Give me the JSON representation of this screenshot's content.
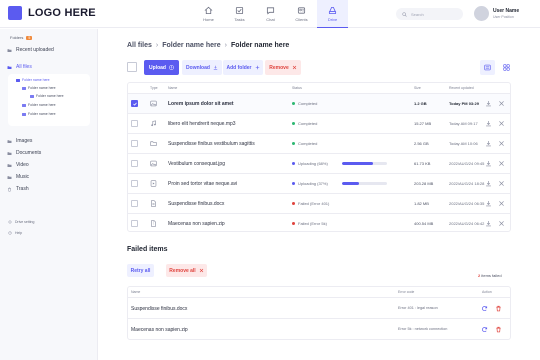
{
  "logo": {
    "text": "LOGO HERE"
  },
  "nav": [
    {
      "label": "Home",
      "icon": "home-icon"
    },
    {
      "label": "Tasks",
      "icon": "tasks-icon"
    },
    {
      "label": "Chat",
      "icon": "chat-icon"
    },
    {
      "label": "Clients",
      "icon": "clients-icon"
    },
    {
      "label": "Drive",
      "icon": "drive-icon",
      "active": true
    }
  ],
  "search": {
    "placeholder": "Search"
  },
  "user": {
    "name": "User Name",
    "position": "User Position"
  },
  "sidebar": {
    "folders_label": "Folders",
    "folders_badge": "5",
    "recent": "Recent uploaded",
    "all_files": "All files",
    "tree": [
      "Folder name here",
      "Folder name here",
      "Folder name here",
      "Folder name here",
      "Folder name here"
    ],
    "categories": [
      "Images",
      "Documents",
      "Video",
      "Music",
      "Trash"
    ],
    "drive_setting": "Drive setting",
    "help": "Help"
  },
  "breadcrumb": [
    "All files",
    "Folder name here",
    "Folder name here"
  ],
  "toolbar": {
    "upload": "Upload",
    "download": "Download",
    "add_folder": "Add folder",
    "remove": "Remove"
  },
  "table": {
    "headers": {
      "type": "Type",
      "name": "Name",
      "status": "Status",
      "size": "Size",
      "recent": "Recent updated"
    },
    "rows": [
      {
        "name": "Lorem ipsum dolor sit amet",
        "status": "Completed",
        "state": "completed",
        "size": "1.2 GB",
        "date": "Today PM 03:29",
        "selected": true,
        "type": "image"
      },
      {
        "name": "libero elit hendrerit neque.mp3",
        "status": "Completed",
        "state": "completed",
        "size": "15.27 MB",
        "date": "Today AM 09:17",
        "type": "music"
      },
      {
        "name": "Suspendisse finibus vestibulum sagittis",
        "status": "Completed",
        "state": "completed",
        "size": "2.56 GB",
        "date": "Today AM 10:06",
        "type": "folder"
      },
      {
        "name": "Vestibulum consequat.jpg",
        "status": "Uploading (68%)",
        "state": "uploading",
        "progress": 68,
        "size": "61.73 KB",
        "date": "2022/AUG/24 09:45",
        "type": "image"
      },
      {
        "name": "Proin sed tortor vitae neque.avi",
        "status": "Uploading (37%)",
        "state": "uploading",
        "progress": 37,
        "size": "203.28 MB",
        "date": "2022/AUG/24 18:28",
        "type": "video"
      },
      {
        "name": "Suspendisse finibus.docx",
        "status": "Failed (Error 401)",
        "state": "failed",
        "size": "1.82 MB",
        "date": "2022/AUG/24 06:35",
        "type": "document"
      },
      {
        "name": "Maecenas non sapien.zip",
        "status": "Failed (Error 5k)",
        "state": "failed",
        "size": "400.54 MB",
        "date": "2022/AUG/24 06:42",
        "type": "archive"
      }
    ]
  },
  "failed": {
    "title": "Failed items",
    "retry_all": "Retry all",
    "remove_all": "Remove all",
    "count_num": "2",
    "count_text": "items failed",
    "headers": {
      "name": "Name",
      "error": "Error code",
      "action": "Action"
    },
    "rows": [
      {
        "name": "Suspendisse finibus.docx",
        "error": "Error 401 : legal reason"
      },
      {
        "name": "Maecenas non sapien.zip",
        "error": "Error 5k : network connection"
      }
    ]
  },
  "colors": {
    "accent": "#5b5bf0",
    "success": "#2eb872",
    "danger": "#e0443e",
    "warning": "#f08a3c"
  }
}
